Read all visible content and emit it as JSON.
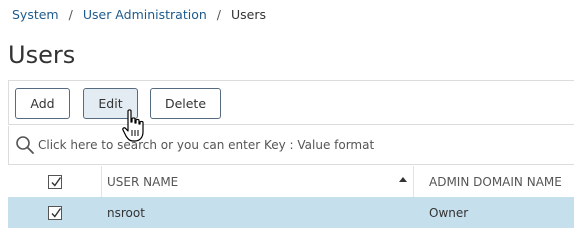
{
  "breadcrumb": {
    "items": [
      "System",
      "User Administration"
    ],
    "separator": "/",
    "current": "Users"
  },
  "page": {
    "title": "Users"
  },
  "toolbar": {
    "add_label": "Add",
    "edit_label": "Edit",
    "delete_label": "Delete"
  },
  "search": {
    "placeholder": "Click here to search or you can enter Key : Value format",
    "value": "",
    "icon": "search-icon"
  },
  "table": {
    "columns": [
      "USER NAME",
      "ADMIN DOMAIN NAME"
    ],
    "sort": {
      "column": "USER NAME",
      "direction": "ascending"
    },
    "header_checked": true,
    "rows": [
      {
        "user_name": "nsroot",
        "admin_domain_name": "Owner",
        "selected": true
      }
    ]
  },
  "colors": {
    "link": "#1f5a8c",
    "selected_row": "#c6dfec",
    "button_border": "#566b7f"
  }
}
